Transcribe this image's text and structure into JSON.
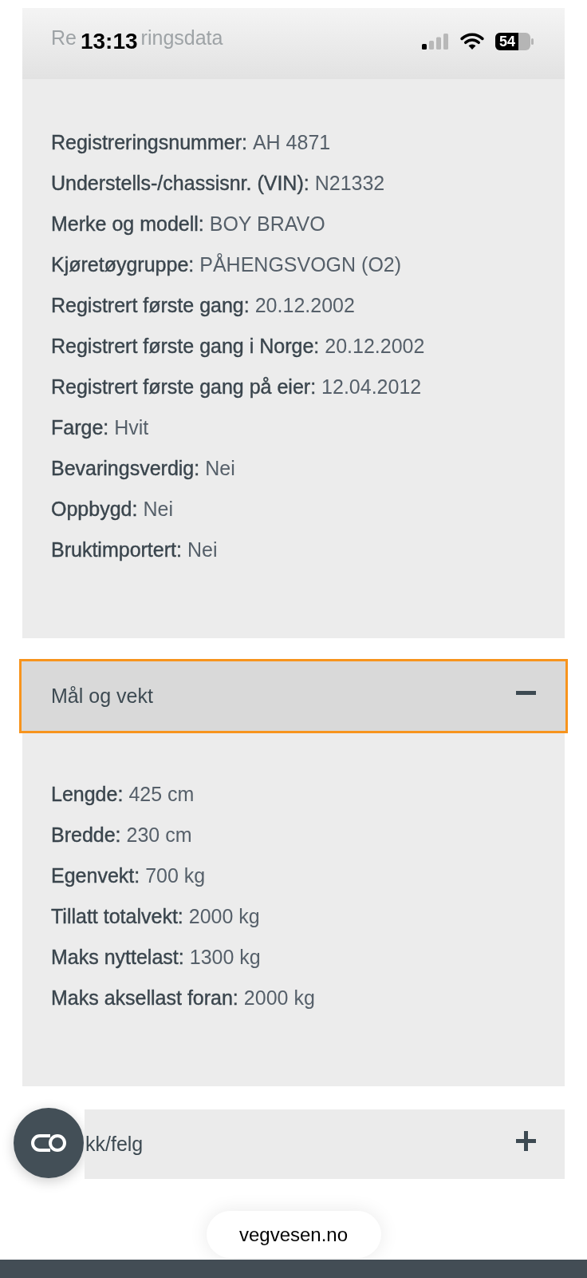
{
  "status_bar": {
    "time": "13:13",
    "battery": "54"
  },
  "sticky_header": {
    "title_start": "Re",
    "title_end": "ringsdata"
  },
  "registration": {
    "fields": [
      {
        "label": "Registreringsnummer:",
        "value": "AH 4871"
      },
      {
        "label": "Understells-/chassisnr. (VIN):",
        "value": "N21332"
      },
      {
        "label": "Merke og modell:",
        "value": "BOY BRAVO"
      },
      {
        "label": "Kjøretøygruppe:",
        "value": "PÅHENGSVOGN (O2)"
      },
      {
        "label": "Registrert første gang:",
        "value": "20.12.2002"
      },
      {
        "label": "Registrert første gang i Norge:",
        "value": "20.12.2002"
      },
      {
        "label": "Registrert første gang på eier:",
        "value": "12.04.2012"
      },
      {
        "label": "Farge:",
        "value": "Hvit"
      },
      {
        "label": "Bevaringsverdig:",
        "value": "Nei"
      },
      {
        "label": "Oppbygd:",
        "value": "Nei"
      },
      {
        "label": "Bruktimportert:",
        "value": "Nei"
      }
    ]
  },
  "accordions": [
    {
      "title": "Mål og vekt",
      "expanded": true,
      "focused": true,
      "fields": [
        {
          "label": "Lengde:",
          "value": "425 cm"
        },
        {
          "label": "Bredde:",
          "value": "230 cm"
        },
        {
          "label": "Egenvekt:",
          "value": "700 kg"
        },
        {
          "label": "Tillatt totalvekt:",
          "value": "2000 kg"
        },
        {
          "label": "Maks nyttelast:",
          "value": "1300 kg"
        },
        {
          "label": "Maks aksellast foran:",
          "value": "2000 kg"
        }
      ]
    },
    {
      "title": "kk/felg",
      "expanded": false,
      "focused": false
    }
  ],
  "address_bar": {
    "url": "vegvesen.no"
  }
}
